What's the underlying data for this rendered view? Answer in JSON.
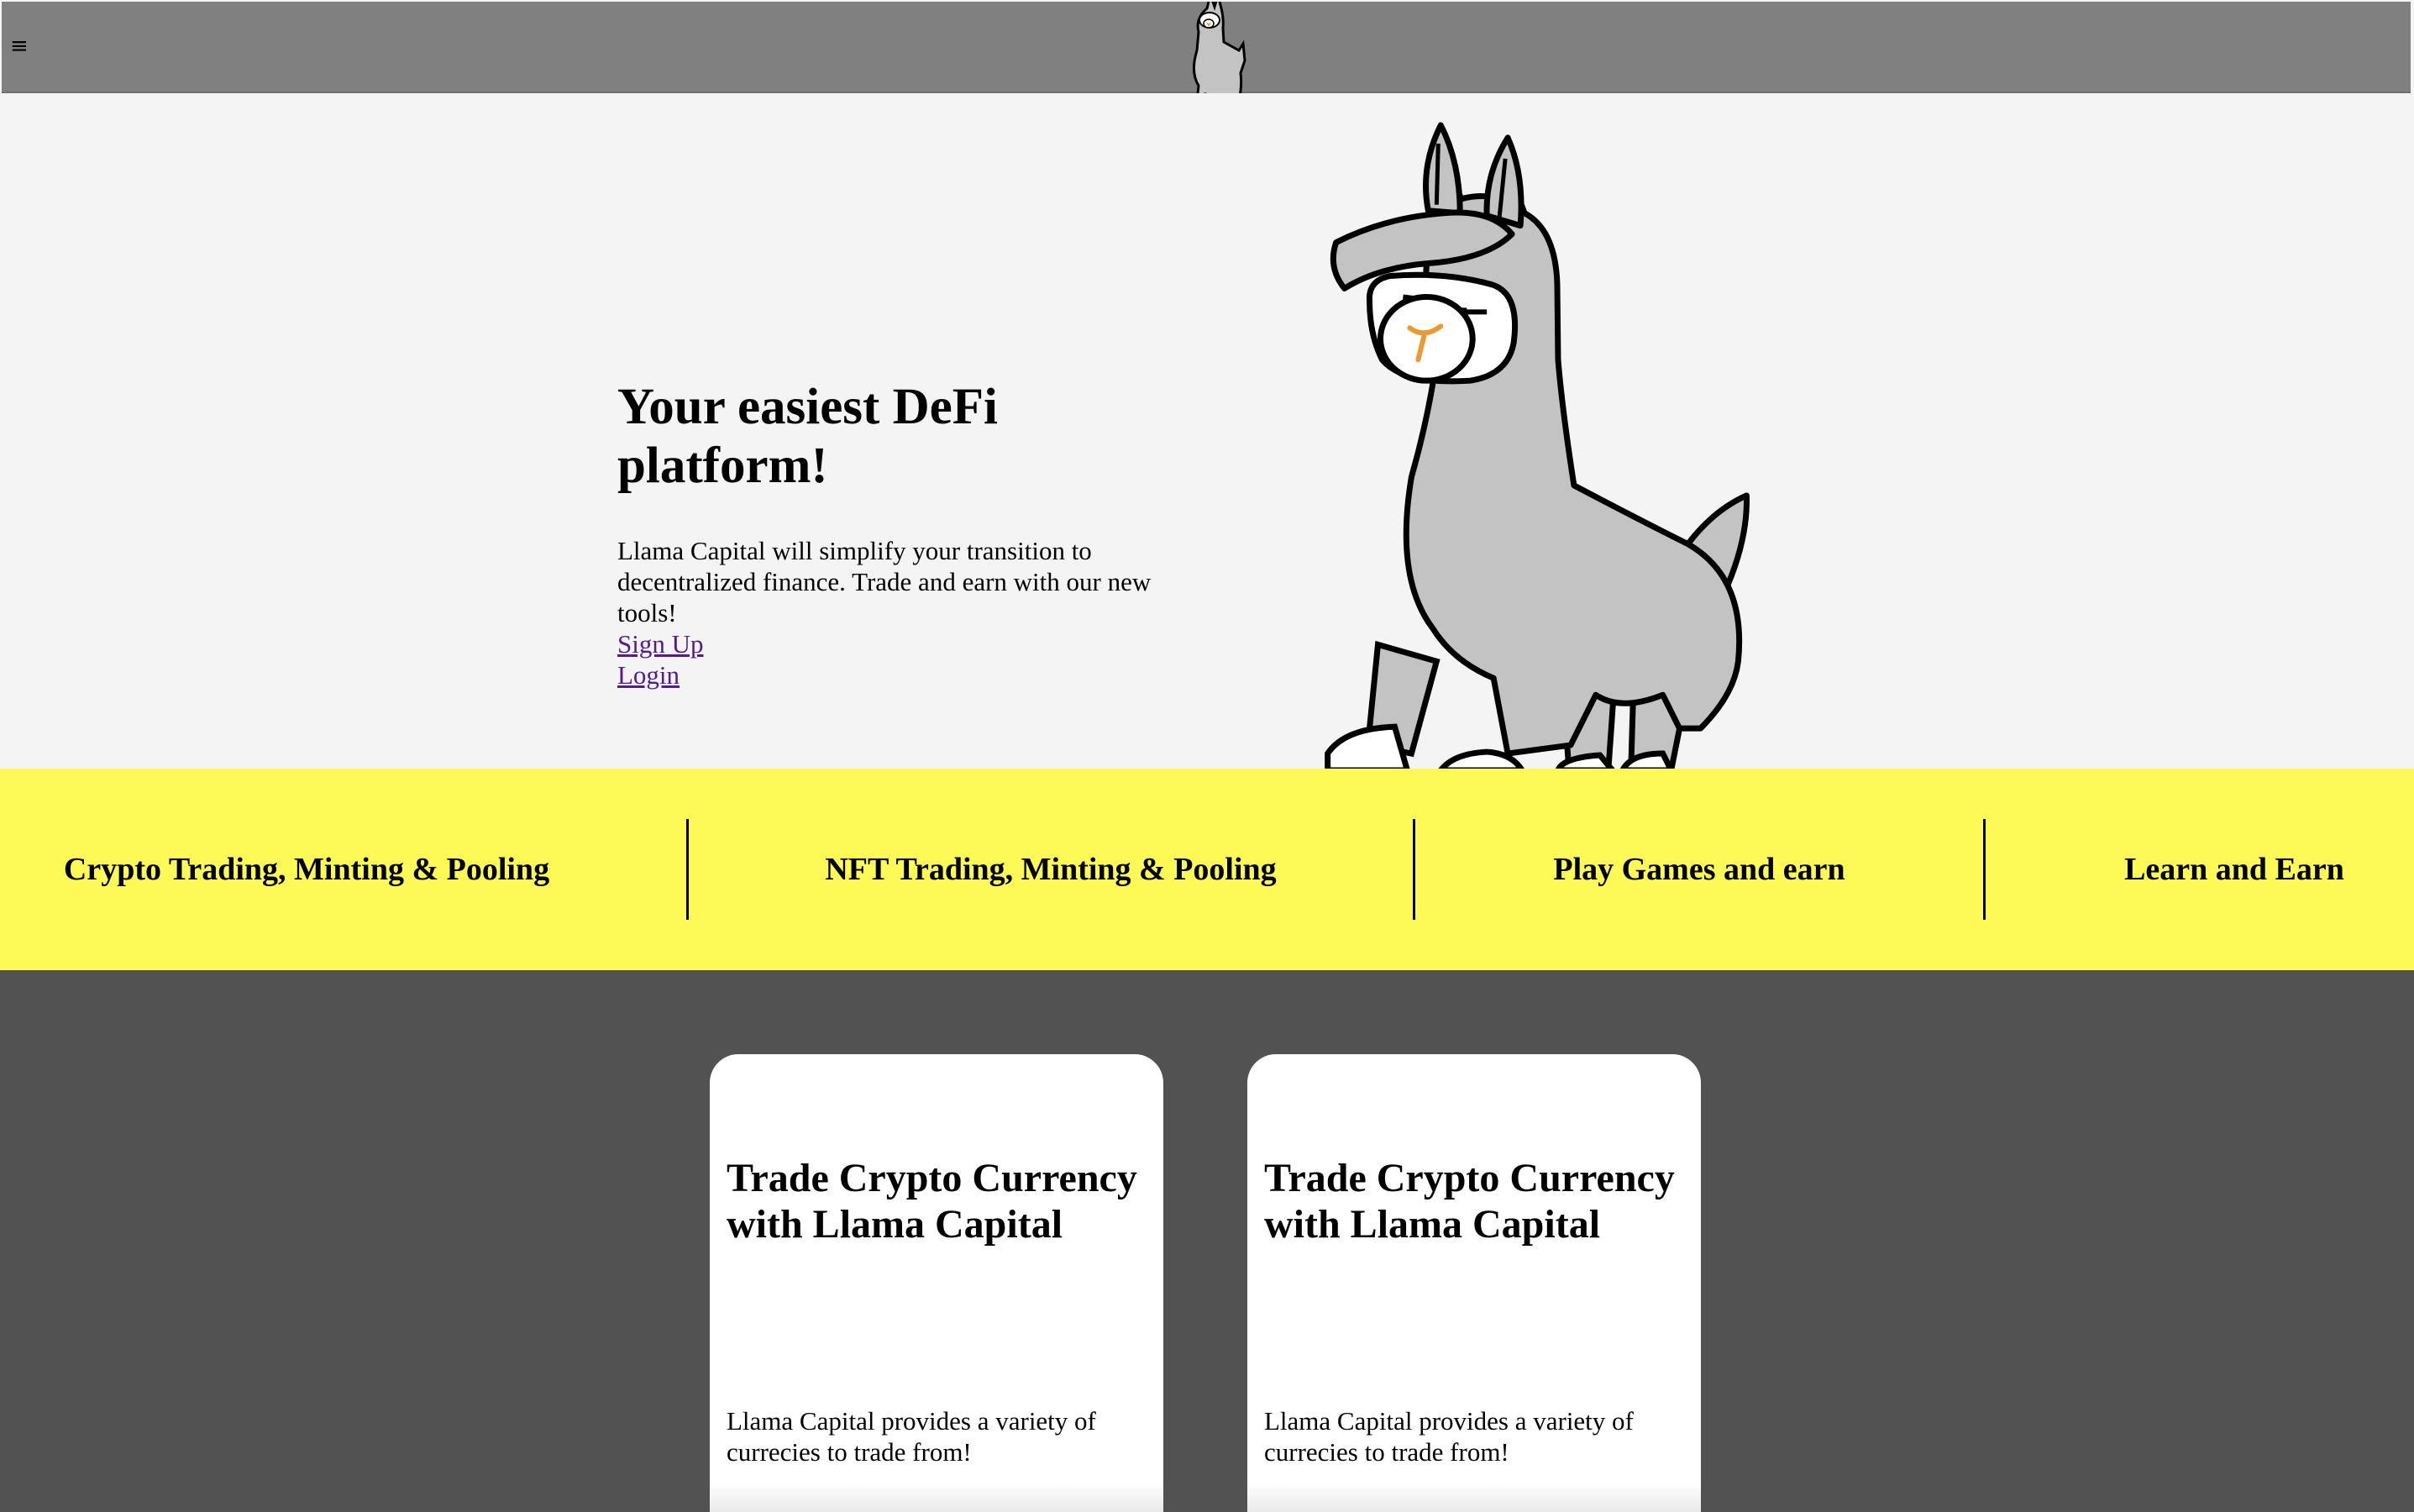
{
  "nav": {
    "menu_icon": "≡",
    "logo": "llama-logo-icon"
  },
  "hero": {
    "title": "Your easiest DeFi platform!",
    "description": "Llama Capital will simplify your transition to decentralized finance. Trade and earn with our new tools!",
    "signup_label": "Sign Up",
    "login_label": "Login",
    "illustration": "llama-illustration"
  },
  "features": {
    "items": [
      {
        "label": "Crypto Trading, Minting & Pooling"
      },
      {
        "label": "NFT Trading, Minting & Pooling"
      },
      {
        "label": "Play Games and earn"
      },
      {
        "label": "Learn and Earn"
      }
    ],
    "background": "#fdfa57"
  },
  "cards": {
    "items": [
      {
        "title": "Trade Crypto Currency with Llama Capital",
        "text": "Llama Capital provides a variety of currecies to trade from!"
      },
      {
        "title": "Trade Crypto Currency with Llama Capital",
        "text": "Llama Capital provides a variety of currecies to trade from!"
      }
    ],
    "section_background": "#525252"
  },
  "colors": {
    "nav_bar": "#808080",
    "hero_background": "#f4f4f4",
    "link": "#551a8b",
    "llama_body": "#c3c3c3"
  }
}
